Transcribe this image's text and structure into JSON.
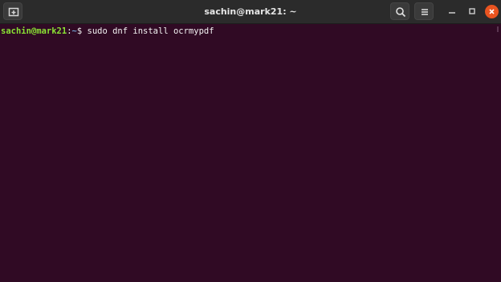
{
  "window": {
    "title": "sachin@mark21: ~"
  },
  "terminal": {
    "prompt_user": "sachin@mark21",
    "prompt_colon": ":",
    "prompt_path": "~",
    "prompt_symbol": "$ ",
    "command": "sudo dnf install ocrmypdf"
  },
  "colors": {
    "background": "#300a24",
    "titlebar": "#2b2b2b",
    "close_button": "#e95420",
    "prompt_user": "#8ae234",
    "prompt_path": "#729fcf"
  },
  "icons": {
    "new_tab": "new-tab-icon",
    "search": "search-icon",
    "menu": "hamburger-menu-icon",
    "minimize": "minimize-icon",
    "maximize": "maximize-icon",
    "close": "close-icon"
  }
}
